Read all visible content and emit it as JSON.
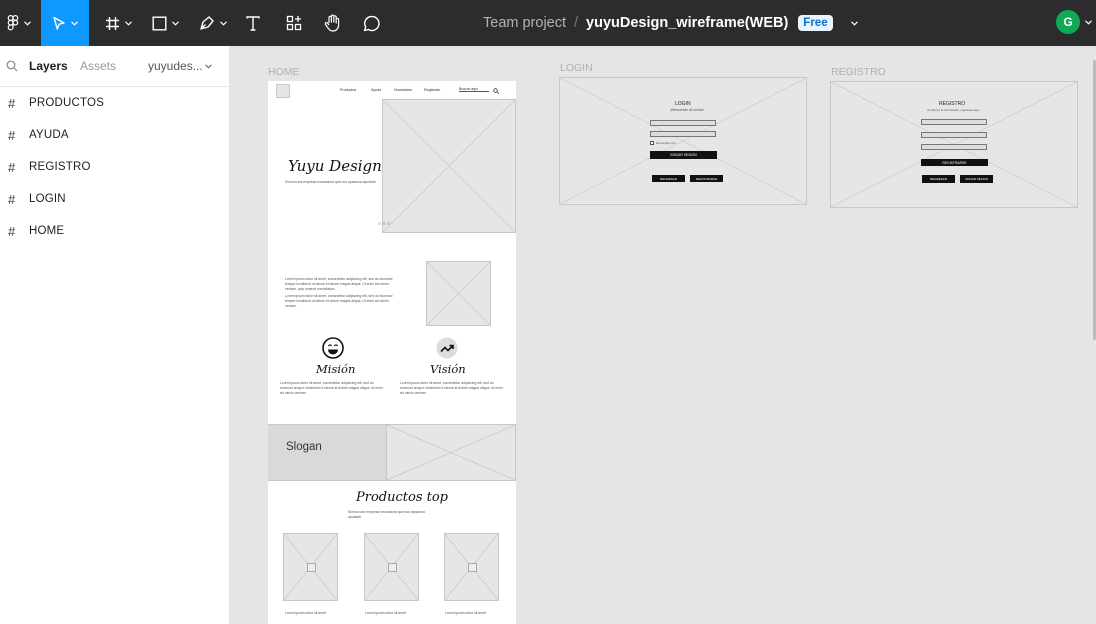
{
  "app": {
    "file_title": "yuyuDesign_wireframe(WEB)",
    "project": "Team project",
    "plan_badge": "Free",
    "user_initial": "G",
    "separator": "/"
  },
  "toolbar": [
    {
      "name": "main-menu",
      "icon": "figma-logo"
    },
    {
      "name": "move-tool",
      "icon": "cursor-arrow",
      "active": true
    },
    {
      "name": "frame-tool",
      "icon": "hash-frame"
    },
    {
      "name": "shape-tool",
      "icon": "rectangle"
    },
    {
      "name": "pen-tool",
      "icon": "pen"
    },
    {
      "name": "text-tool",
      "icon": "text-T"
    },
    {
      "name": "resources-tool",
      "icon": "components"
    },
    {
      "name": "hand-tool",
      "icon": "hand"
    },
    {
      "name": "comment-tool",
      "icon": "speech-bubble"
    }
  ],
  "left_panel": {
    "tabs": {
      "layers": "Layers",
      "assets": "Assets",
      "page": "yuyudes..."
    },
    "layers": [
      "PRODUCTOS",
      "AYUDA",
      "REGISTRO",
      "LOGIN",
      "HOME"
    ]
  },
  "canvas": {
    "labels": {
      "home": "HOME",
      "login": "LOGIN",
      "registro": "REGISTRO"
    },
    "home": {
      "nav": [
        "Productos",
        "Ayuda",
        "Novedades",
        "Registrate",
        "Buscar aquí"
      ],
      "brand": "Yuyu Design",
      "brand_sub": "Somos una empresa innovadora que nos apasiona ayudarte",
      "carousel_dots": "○ ○ ○",
      "about_p1": "Lorem ipsum dolor sit amet, consectetur adipiscing elit, sed do eiusmod tempor incididunt ut labore et dolore magna aliqua. Ut enim ad minim veniam, quis nostrud exercitation.",
      "about_p2": "Lorem ipsum dolor sit amet, consectetur adipiscing elit, sed do eiusmod tempor incididunt ut labore et dolore magna aliqua. Ut enim ad minim veniam.",
      "mision": "Misión",
      "vision": "Visión",
      "mision_text": "Lorem ipsum dolor sit amet, consectetur adipiscing elit, sed do eiusmod tempor incididunt ut labore et dolore magna aliqua. Ut enim ad minim veniam.",
      "vision_text": "Lorem ipsum dolor sit amet, consectetur adipiscing elit, sed do eiusmod tempor incididunt ut labore et dolore magna aliqua. Ut enim ad minim veniam.",
      "slogan": "Slogan",
      "productos_title": "Productos top",
      "productos_sub": "Somos una empresa innovadora que nos apasiona ayudarte",
      "product_caption": "Lorem ipsum dolor sit amet"
    },
    "login": {
      "title": "LOGIN",
      "subtitle": "¡Bienvenido de vuelta!",
      "remember": "Remember me",
      "primary": "INICIAR SESION",
      "btn1": "REGRESAR",
      "btn2": "REGISTRARSE"
    },
    "registro": {
      "title": "REGISTRO",
      "subtitle": "Te damos la bienvenida, registrate aquí",
      "primary": "REGISTRARSE",
      "btn1": "REGRESAR",
      "btn2": "INICIAR SESION"
    }
  },
  "colors": {
    "toolbar_bg": "#2c2c2c",
    "active_tool": "#0d99ff",
    "avatar": "#0fa958",
    "badge_bg": "#e5f4ff",
    "canvas_bg": "#e5e5e5"
  }
}
